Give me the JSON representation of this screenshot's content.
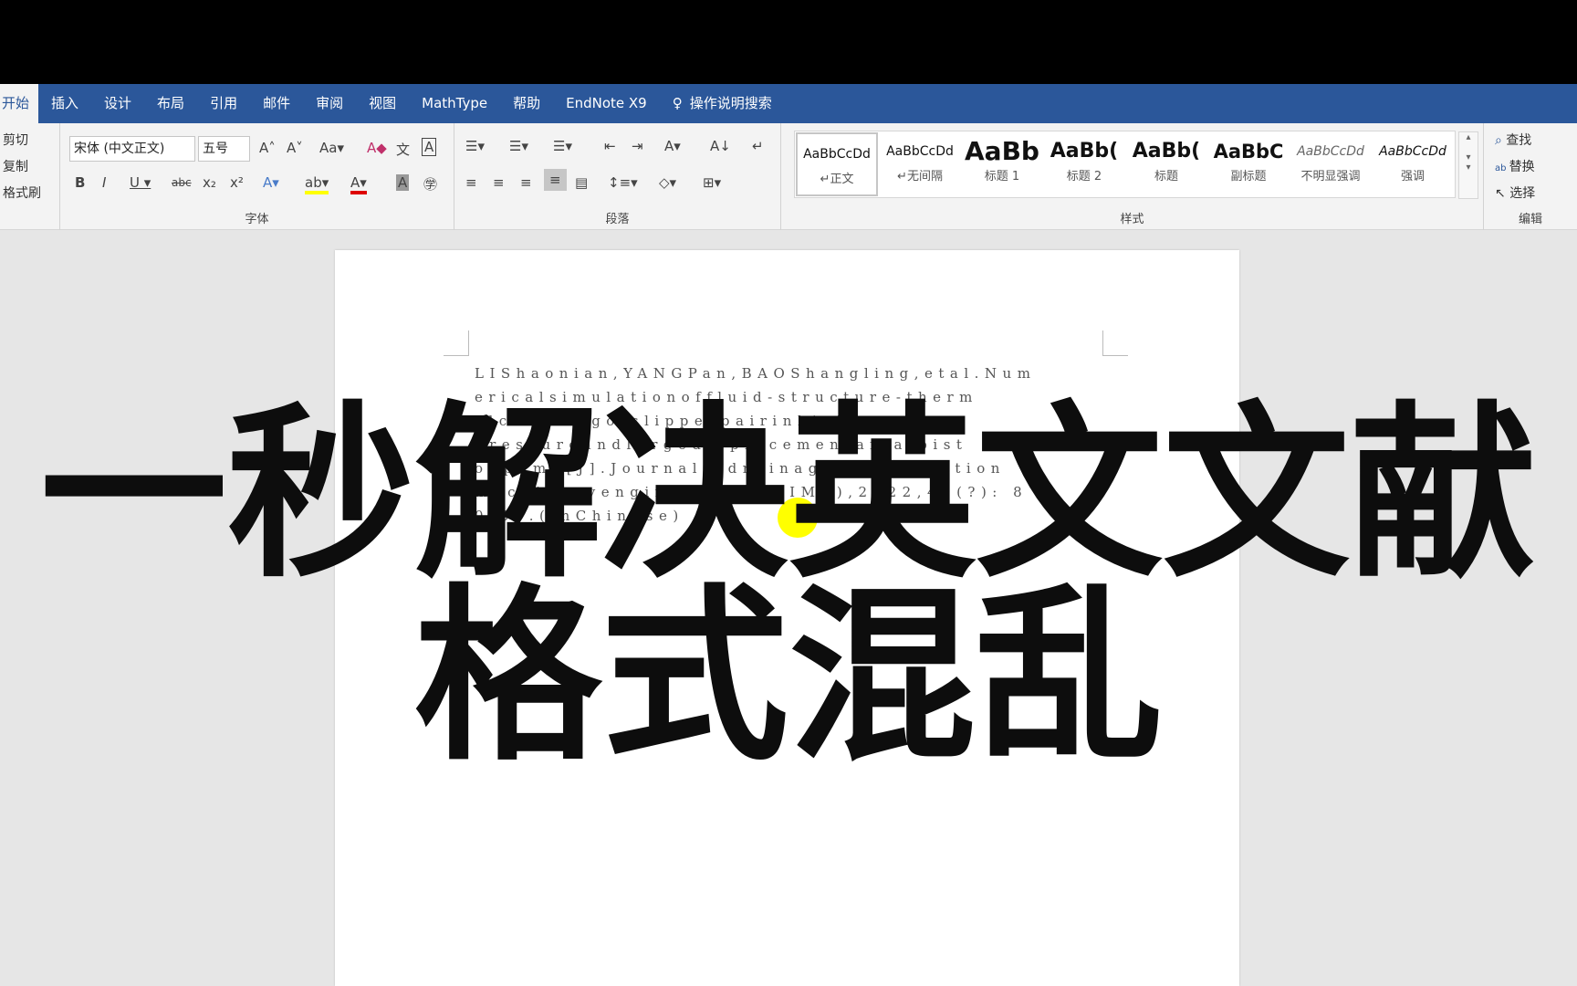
{
  "tabs": [
    "开始",
    "插入",
    "设计",
    "布局",
    "引用",
    "邮件",
    "审阅",
    "视图",
    "MathType",
    "帮助",
    "EndNote X9"
  ],
  "search_label": "操作说明搜索",
  "clipboard": {
    "items": [
      "剪切",
      "复制",
      "格式刷"
    ]
  },
  "font": {
    "name": "宋体 (中文正文)",
    "size": "五号",
    "label": "字体"
  },
  "paragraph": {
    "label": "段落"
  },
  "styles": {
    "label": "样式",
    "items": [
      {
        "preview": "AaBbCcDd",
        "name": "↵正文"
      },
      {
        "preview": "AaBbCcDd",
        "name": "↵无间隔"
      },
      {
        "preview": "AaBb",
        "name": "标题 1"
      },
      {
        "preview": "AaBb(",
        "name": "标题 2"
      },
      {
        "preview": "AaBb(",
        "name": "标题"
      },
      {
        "preview": "AaBbC",
        "name": "副标题"
      },
      {
        "preview": "AaBbCcDd",
        "name": "不明显强调"
      },
      {
        "preview": "AaBbCcDd",
        "name": "强调"
      }
    ]
  },
  "editing": {
    "label": "编辑",
    "items": [
      "查找",
      "替换",
      "选择"
    ]
  },
  "document": {
    "lines": [
      "LIShaonian,YANGPan,BAOShangling,etal.Num",
      "ericalsimulationoffluid-structure-therm",
      "alcouplingofslipperpairinhigh",
      "pressureandlargedisplacementaxialpist",
      "onpump[J].Journalofdrainageandirrigation",
      "machineryengineering(JDIME),2022,40(?): 8",
      "0-87.(inChinese)"
    ]
  },
  "overlay": {
    "line1": "一秒解决英文文献",
    "line2": "格式混乱"
  },
  "colors": {
    "tabbar": "#2b579a",
    "ribbon": "#f3f3f3",
    "highlight": "#ffff00"
  }
}
